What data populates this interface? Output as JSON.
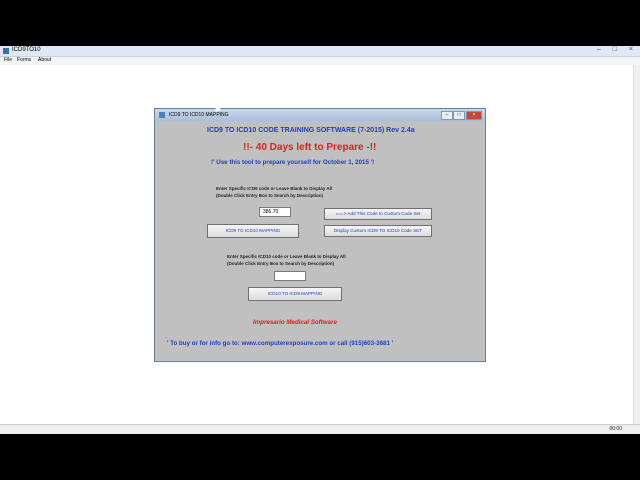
{
  "app": {
    "title": "ICD9TO10",
    "controls": "– □ ×",
    "menu": [
      "File",
      "Forms",
      "About"
    ],
    "status_time": "00:00"
  },
  "dialog": {
    "title": "ICD9 TO ICD10 MAPPING",
    "controls": {
      "minimize": "–",
      "maximize": "□",
      "close": "×"
    },
    "heading": "ICD9  TO ICD10  CODE TRAINING SOFTWARE     (7-2015) Rev 2.4a",
    "countdown": "!!-  40  Days left to Prepare -!!",
    "prepare_note": "!' Use this tool to prepare yourself for October 1, 2015 '!",
    "icd9_instructions": {
      "line1": "Enter Specific ICD9 code or Leave Blank to Display All",
      "line2": "(Double Click Entry Box to Search by Description)"
    },
    "icd9_input_value": "386.70",
    "add_button": "===> Add This Code to Custom Code Set",
    "display_button": "Display Custom ICD9 TO ICD10  Code SET",
    "icd9_mapping_button": "ICD9 TO ICD10 MAPPING",
    "icd10_instructions": {
      "line1": "Enter Specific ICD10 code or Leave Blank to Display All",
      "line2": "(Double Click Entry Box to Search by Description)"
    },
    "icd10_input_value": "",
    "icd10_mapping_button": "ICD10 TO ICD9 MAPPING",
    "company": "Impresario Medical Software",
    "buy_info": "' To buy or for info go to:  www.computerexposure.com or call (915)603-3681 '"
  }
}
